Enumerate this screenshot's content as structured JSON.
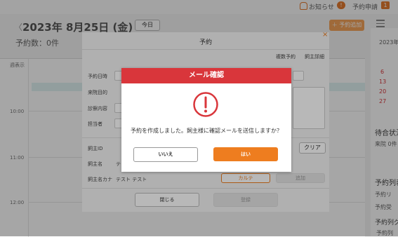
{
  "topbar": {
    "notice_label": "お知らせ",
    "notice_count": "!",
    "request_label": "予約申請",
    "request_count": "1"
  },
  "header": {
    "date": "2023年  8月25日 (金)",
    "prev": "〈",
    "next": "〉",
    "today_label": "今日",
    "count_label": "予約数：0件",
    "add_label": "＋ 予約追加"
  },
  "calendar": {
    "week_label": "週表示",
    "hours": [
      "10:00",
      "11:00",
      "12:00"
    ]
  },
  "side": {
    "year": "2023年",
    "days": [
      "6",
      "13",
      "20",
      "27"
    ],
    "wait_label": "待合状況",
    "wait_item": "来院 0件",
    "list_label": "予約列表",
    "list_item1": "予約リ",
    "list_item2": "予約受",
    "group_label": "予約列グル",
    "group_item": "予約列"
  },
  "modal": {
    "title": "予約",
    "close": "×",
    "multi_label": "複数予約",
    "owner_detail_label": "飼主詳細",
    "labels": {
      "datetime": "予約日時",
      "purpose": "来院目的",
      "content": "診察内容",
      "staff": "担当者",
      "owner_id": "飼主ID",
      "owner_name": "飼主名",
      "owner_kana": "飼主名カナ"
    },
    "owner_name_value": "テ",
    "owner_kana_value": "テスト テスト",
    "clear_label": "クリア",
    "karte_label": "カルテ",
    "bottom_right_label": "追加",
    "close_label": "閉じる",
    "register_label": "登録"
  },
  "dialog": {
    "title": "メール確認",
    "message": "予約を作成しました。飼主様に確認メールを送信しますか？",
    "no_label": "いいえ",
    "yes_label": "はい",
    "accent": "#d9363b",
    "primary": "#ee7d1f"
  }
}
